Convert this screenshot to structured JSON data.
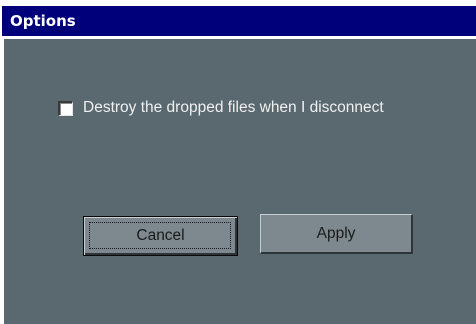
{
  "window": {
    "title": "Options"
  },
  "options": {
    "destroy_files": {
      "label": "Destroy the dropped files when I disconnect",
      "checked": false
    }
  },
  "buttons": {
    "cancel_label": "Cancel",
    "apply_label": "Apply"
  },
  "colors": {
    "titlebar": "#00007b",
    "client_background": "#5a6970",
    "button_face": "#7d898e"
  }
}
